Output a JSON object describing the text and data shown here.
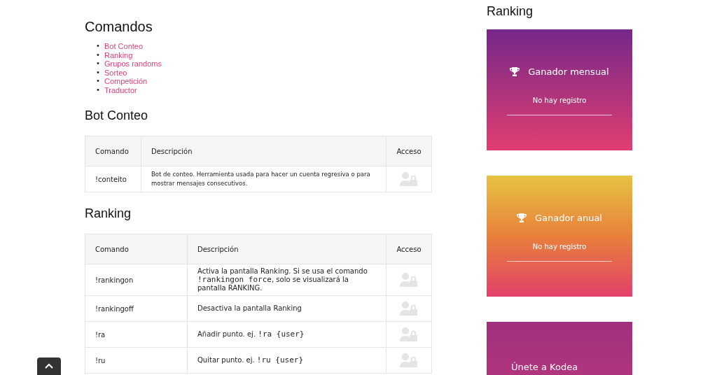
{
  "main": {
    "title": "Comandos",
    "toc": [
      {
        "bullet": "•",
        "label": "Bot Conteo"
      },
      {
        "bullet": "•",
        "label": "Ranking"
      },
      {
        "bullet": "•",
        "label": "Grupos randoms"
      },
      {
        "bullet": "•",
        "label": "Sorteo"
      },
      {
        "bullet": "•",
        "label": "Competición"
      },
      {
        "bullet": "•",
        "label": "Traductor"
      }
    ],
    "sections": [
      {
        "heading": "Bot Conteo",
        "columns": [
          "Comando",
          "Descripción",
          "Acceso"
        ],
        "rows": [
          {
            "command": "!conteito",
            "description": [
              {
                "kind": "text",
                "text": "Bot de conteo. Herramienta usada para hacer un cuenta regresiva o para mostrar mensajes consecutivos."
              }
            ]
          }
        ]
      },
      {
        "heading": "Ranking",
        "columns": [
          "Comando",
          "Descripción",
          "Acceso"
        ],
        "rows": [
          {
            "command": "!rankingon",
            "description": [
              {
                "kind": "text",
                "text": "Activa la pantalla Ranking. Si se usa el comando "
              },
              {
                "kind": "code",
                "text": "!rankingon force"
              },
              {
                "kind": "text",
                "text": ", solo se visualizará la pantalla RANKING."
              }
            ]
          },
          {
            "command": "!rankingoff",
            "description": [
              {
                "kind": "text",
                "text": "Desactiva la pantalla Ranking"
              }
            ]
          },
          {
            "command": "!ra",
            "description": [
              {
                "kind": "text",
                "text": "Añadir punto. ej. "
              },
              {
                "kind": "code",
                "text": "!ra {user}"
              }
            ]
          },
          {
            "command": "!ru",
            "description": [
              {
                "kind": "text",
                "text": "Quitar punto. ej. "
              },
              {
                "kind": "code",
                "text": "!ru {user}"
              }
            ]
          }
        ]
      }
    ]
  },
  "sidebar": {
    "title": "Ranking",
    "cards": [
      {
        "kind": "monthly",
        "title": "Ganador mensual",
        "text": "No hay registro"
      },
      {
        "kind": "annual",
        "title": "Ganador anual",
        "text": "No hay registro"
      },
      {
        "kind": "join",
        "title": "Únete a Kodea"
      }
    ]
  }
}
